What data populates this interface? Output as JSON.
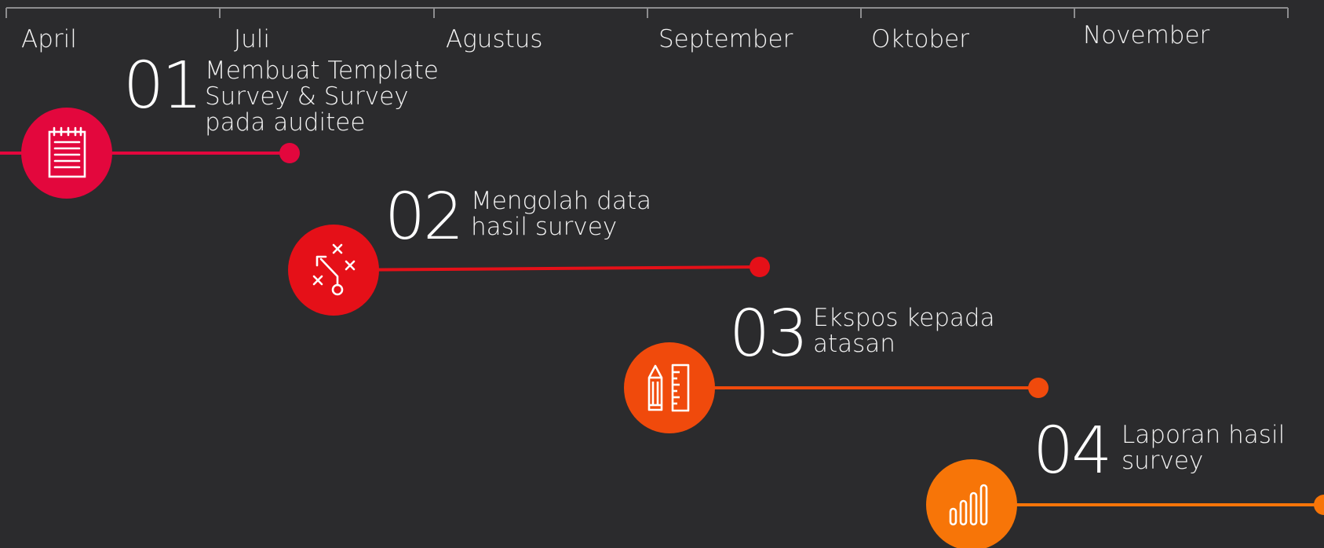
{
  "months": [
    "April",
    "Juli",
    "Agustus",
    "September",
    "Oktober",
    "November"
  ],
  "steps": [
    {
      "number": "01",
      "lines": [
        "Membuat Template",
        "Survey & Survey",
        "pada auditee"
      ],
      "color": "#e3073d",
      "icon": "notepad-icon"
    },
    {
      "number": "02",
      "lines": [
        "Mengolah data",
        "hasil survey"
      ],
      "color": "#e51018",
      "icon": "strategy-play-icon"
    },
    {
      "number": "03",
      "lines": [
        "Ekspos kepada",
        "atasan"
      ],
      "color": "#f04a0c",
      "icon": "pencil-ruler-icon"
    },
    {
      "number": "04",
      "lines": [
        "Laporan hasil",
        "survey"
      ],
      "color": "#f77508",
      "icon": "bar-chart-icon"
    }
  ]
}
